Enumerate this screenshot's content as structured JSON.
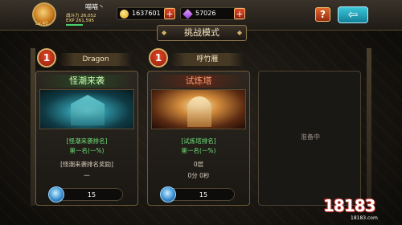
{
  "player": {
    "name": "喵喵丶",
    "level": "Lv.40",
    "power_line": "战斗力 26,052",
    "exp_line": "EXP 261,595",
    "exp_fraction": 0.35
  },
  "resources": {
    "gold": "1637601",
    "gems": "57026"
  },
  "header": {
    "title": "挑战模式",
    "help_label": "?",
    "back_label": "⇦"
  },
  "cards": [
    {
      "rank": "1",
      "top_name": "Dragon",
      "title": "怪潮来袭",
      "rank_title": "[怪潮来袭排名]",
      "rank_value": "第一名(一%)",
      "extra1": "[怪潮来袭排名奖励]",
      "extra2": "一",
      "cost": "15"
    },
    {
      "rank": "1",
      "top_name": "呼竹雁",
      "title": "试炼塔",
      "rank_title": "[试炼塔排名]",
      "rank_value": "第一名(一%)",
      "extra1": "0层",
      "extra2": "0分 0秒",
      "cost": "15"
    }
  ],
  "locked_card": {
    "label": "准备中"
  },
  "watermark": {
    "logo": "18183",
    "url": "18183.com"
  }
}
